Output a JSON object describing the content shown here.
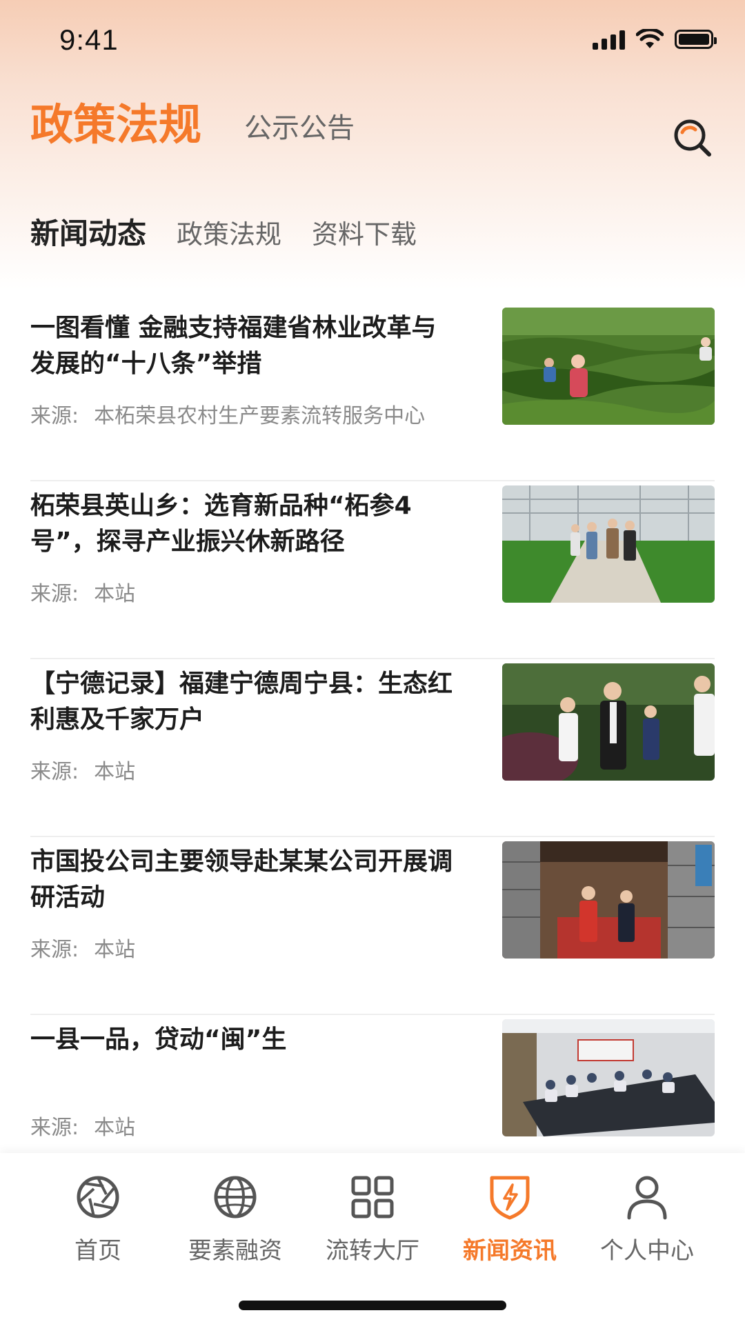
{
  "status_bar": {
    "time": "9:41"
  },
  "header": {
    "active_tab": "政策法规",
    "tab_2": "公示公告"
  },
  "sub_tabs": {
    "items": [
      "新闻动态",
      "政策法规",
      "资料下载"
    ],
    "active_index": 0
  },
  "news": [
    {
      "title": "一图看懂 金融支持福建省林业改革与发展的“十八条”举措",
      "source_label": "来源:",
      "source": "本柘荣县农村生产要素流转服务中心",
      "thumb": "tea-plantation-workers"
    },
    {
      "title": "柘荣县英山乡：选育新品种“柘参4号”，探寻产业振兴休新路径",
      "source_label": "来源:",
      "source": "本站",
      "thumb": "greenhouse-visit"
    },
    {
      "title": "【宁德记录】福建宁德周宁县：生态红利惠及千家万户",
      "source_label": "来源:",
      "source": "本站",
      "thumb": "officials-outdoor-visit"
    },
    {
      "title": "市国投公司主要领导赴某某公司开展调研活动",
      "source_label": "来源:",
      "source": "本站",
      "thumb": "stone-building-meeting"
    },
    {
      "title": "一县一品，贷动“闽”生",
      "source_label": "来源:",
      "source": "本站",
      "thumb": "conference-room"
    }
  ],
  "bottom_nav": {
    "items": [
      {
        "label": "首页",
        "icon": "aperture-icon"
      },
      {
        "label": "要素融资",
        "icon": "globe-icon"
      },
      {
        "label": "流转大厅",
        "icon": "grid-icon"
      },
      {
        "label": "新闻资讯",
        "icon": "shield-bolt-icon"
      },
      {
        "label": "个人中心",
        "icon": "user-icon"
      }
    ],
    "active_index": 3
  },
  "colors": {
    "accent": "#f5792a",
    "text_primary": "#1c1c1c",
    "text_secondary": "#8a8a8a"
  }
}
